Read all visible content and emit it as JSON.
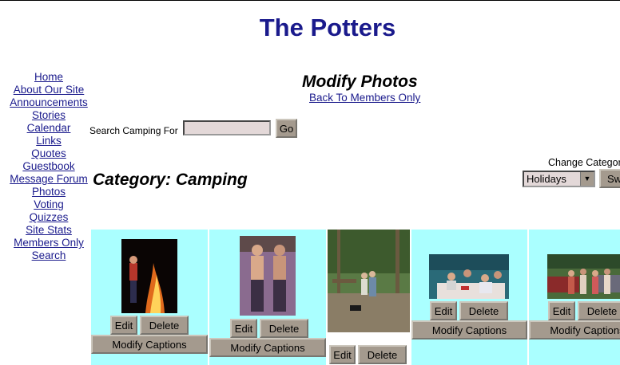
{
  "site": {
    "title": "The Potters"
  },
  "nav": {
    "items": [
      {
        "label": "Home"
      },
      {
        "label": "About Our Site"
      },
      {
        "label": "Announcements"
      },
      {
        "label": "Stories"
      },
      {
        "label": "Calendar"
      },
      {
        "label": "Links"
      },
      {
        "label": "Quotes"
      },
      {
        "label": "Guestbook"
      },
      {
        "label": "Message Forum"
      },
      {
        "label": "Photos"
      },
      {
        "label": "Voting"
      },
      {
        "label": "Quizzes"
      },
      {
        "label": "Site Stats"
      },
      {
        "label": "Members Only"
      },
      {
        "label": "Search"
      }
    ]
  },
  "page": {
    "heading": "Modify Photos",
    "back_link": "Back To Members Only"
  },
  "search": {
    "label": "Search Camping For",
    "value": "",
    "go_label": "Go"
  },
  "category_switch": {
    "label": "Change Category",
    "selected": "Holidays",
    "button_label": "Switch"
  },
  "category": {
    "heading": "Category: Camping"
  },
  "photos": [
    {
      "edit": "Edit",
      "delete": "Delete",
      "captions": "Modify Captions"
    },
    {
      "edit": "Edit",
      "delete": "Delete",
      "captions": "Modify Captions"
    },
    {
      "edit": "Edit",
      "delete": "Delete"
    },
    {
      "edit": "Edit",
      "delete": "Delete",
      "captions": "Modify Captions"
    },
    {
      "edit": "Edit",
      "delete": "Delete",
      "captions": "Modify Captions"
    }
  ],
  "colors": {
    "title": "#1a1a8c",
    "cell_bg": "#aaffff",
    "button_bg": "#a49a8e",
    "input_bg": "#e3d8d8"
  }
}
